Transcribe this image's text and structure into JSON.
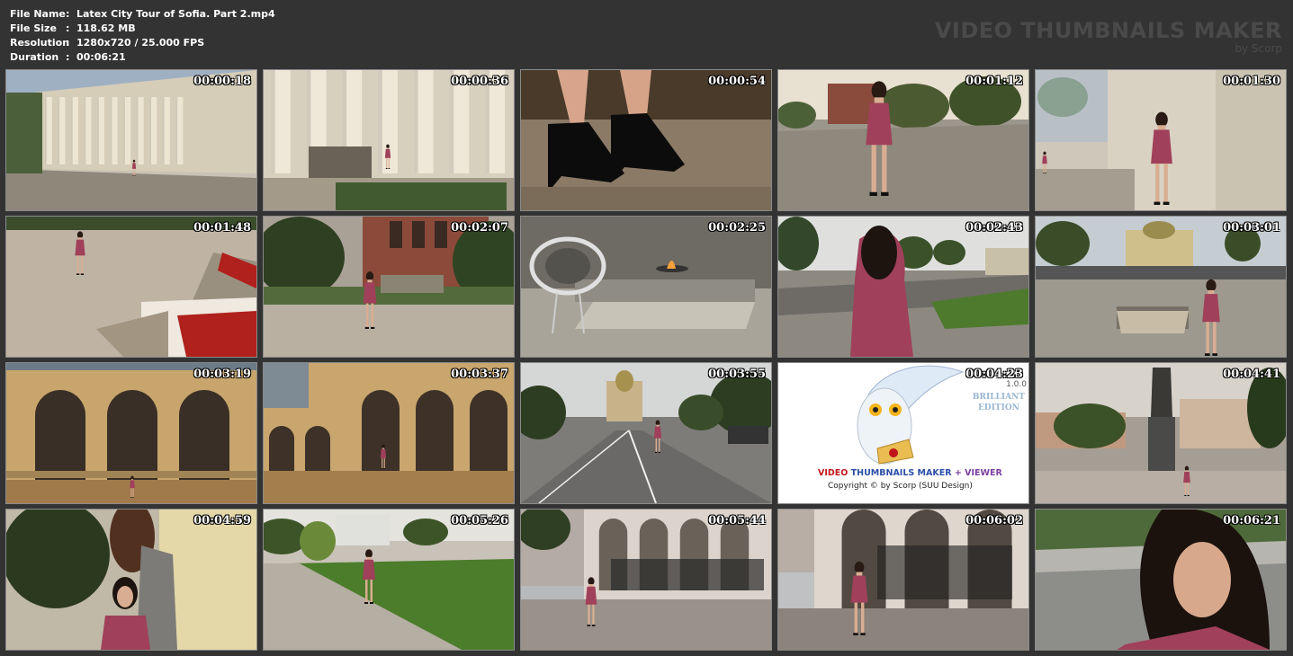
{
  "info": {
    "rows": [
      {
        "key": "File Name",
        "sep": ":",
        "value": "Latex City Tour of Sofia. Part 2.mp4"
      },
      {
        "key": "File Size",
        "sep": ":",
        "value": "118.62 MB"
      },
      {
        "key": "Resolution",
        "sep": ":",
        "value": "1280x720 / 25.000 FPS"
      },
      {
        "key": "Duration",
        "sep": ":",
        "value": "00:06:21"
      }
    ]
  },
  "brand": {
    "title": "VIDEO THUMBNAILS MAKER",
    "sub": "by Scorp"
  },
  "thumbnails": [
    {
      "ts": "00:00:18",
      "scene": "building-colonnade"
    },
    {
      "ts": "00:00:36",
      "scene": "columns-woman"
    },
    {
      "ts": "00:00:54",
      "scene": "heels-closeup"
    },
    {
      "ts": "00:01:12",
      "scene": "woman-walking-square"
    },
    {
      "ts": "00:01:30",
      "scene": "woman-leaning-wall"
    },
    {
      "ts": "00:01:48",
      "scene": "flowerbed-steps"
    },
    {
      "ts": "00:02:07",
      "scene": "woman-church-garden"
    },
    {
      "ts": "00:02:25",
      "scene": "eternal-flame-memorial"
    },
    {
      "ts": "00:02:43",
      "scene": "woman-back-street"
    },
    {
      "ts": "00:03:01",
      "scene": "woman-square-cathedral"
    },
    {
      "ts": "00:03:19",
      "scene": "cathedral-arches"
    },
    {
      "ts": "00:03:37",
      "scene": "cathedral-arches-woman"
    },
    {
      "ts": "00:03:55",
      "scene": "road-cathedral"
    },
    {
      "ts": "00:04:23",
      "scene": "app-logo"
    },
    {
      "ts": "00:04:41",
      "scene": "monument-square"
    },
    {
      "ts": "00:04:59",
      "scene": "woman-statue-closeup"
    },
    {
      "ts": "00:05:26",
      "scene": "park-path-woman"
    },
    {
      "ts": "00:05:44",
      "scene": "church-fence-car"
    },
    {
      "ts": "00:06:02",
      "scene": "woman-church-steps"
    },
    {
      "ts": "00:06:21",
      "scene": "woman-face-closeup"
    }
  ],
  "logo_card": {
    "version": "1.0.0",
    "edition_1": "BRILLIANT",
    "edition_2": "EDITION",
    "title_part1": "VIDEO",
    "title_part2": "THUMBNAILS MAKER",
    "title_part3": "+ VIEWER",
    "copyright": "Copyright © by Scorp (SUU Design)"
  },
  "colors": {
    "background": "#333333",
    "latex_dress": "#a0405a",
    "sky": "#b9c4cc",
    "stone": "#c8b79a",
    "foliage": "#3f5a2e"
  }
}
